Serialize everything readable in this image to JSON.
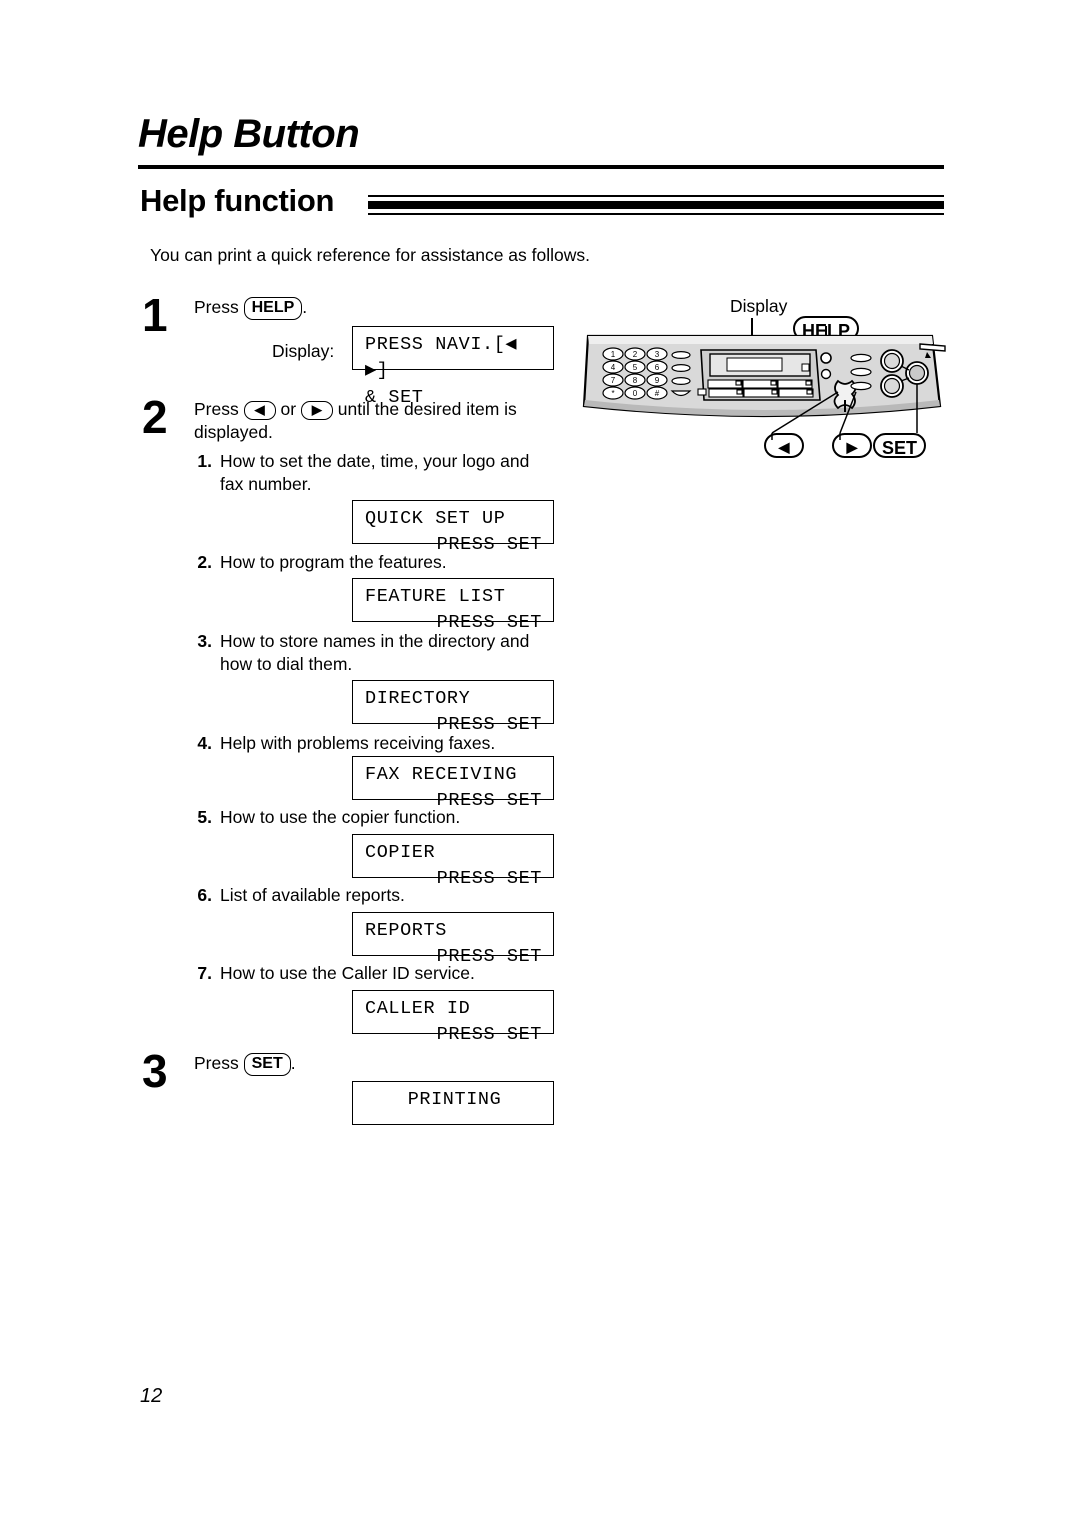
{
  "document": {
    "chapter_title": "Help Button",
    "section_title": "Help function",
    "intro": "You can print a quick reference for assistance as follows.",
    "page_number": "12"
  },
  "steps": {
    "step1": {
      "number": "1",
      "text_before": "Press",
      "key": "HELP",
      "text_after": ".",
      "display_label": "Display:",
      "display": {
        "line1": "PRESS NAVI.[◀ ▶]",
        "line2": "& SET"
      }
    },
    "step2": {
      "number": "2",
      "text_before": "Press",
      "key_left": "◀",
      "text_middle": "or",
      "key_right": "▶",
      "text_after": "until the desired item is displayed."
    },
    "step3": {
      "number": "3",
      "text_before": "Press",
      "key": "SET",
      "text_after": ".",
      "display": {
        "line1": "PRINTING",
        "line2": ""
      }
    }
  },
  "items": [
    {
      "label": "1.",
      "text": "How to set the date, time, your logo and fax number.",
      "display": {
        "line1": "QUICK SET UP",
        "line2": "PRESS SET"
      }
    },
    {
      "label": "2.",
      "text": "How to program the features.",
      "display": {
        "line1": "FEATURE LIST",
        "line2": "PRESS SET"
      }
    },
    {
      "label": "3.",
      "text": "How to store names in the directory and how to dial them.",
      "display": {
        "line1": "DIRECTORY",
        "line2": "PRESS SET"
      }
    },
    {
      "label": "4.",
      "text": "Help with problems receiving faxes.",
      "display": {
        "line1": "FAX RECEIVING",
        "line2": "PRESS SET"
      }
    },
    {
      "label": "5.",
      "text": "How to use the copier function.",
      "display": {
        "line1": "COPIER",
        "line2": "PRESS SET"
      }
    },
    {
      "label": "6.",
      "text": "List of available reports.",
      "display": {
        "line1": "REPORTS",
        "line2": "PRESS SET"
      }
    },
    {
      "label": "7.",
      "text": "How to use the Caller ID service.",
      "display": {
        "line1": "CALLER ID",
        "line2": "PRESS SET"
      }
    }
  ],
  "figure": {
    "display_label": "Display",
    "callout_help": "HELP",
    "callout_set": "SET",
    "callout_left": "◀",
    "callout_right": "▶",
    "keypad": [
      "1",
      "2",
      "3",
      "4",
      "5",
      "6",
      "7",
      "8",
      "9",
      "✱",
      "0",
      "#"
    ]
  }
}
